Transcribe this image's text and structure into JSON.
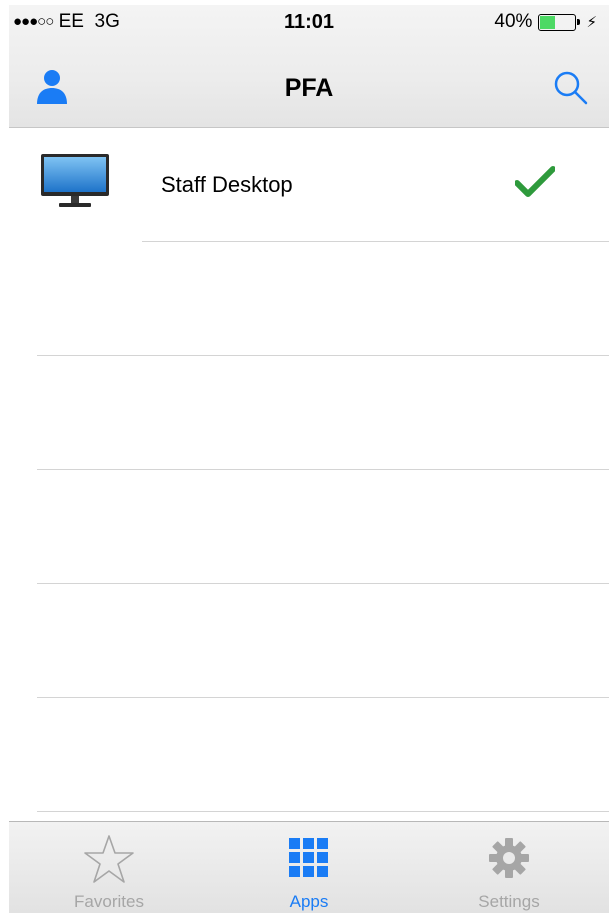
{
  "status_bar": {
    "signal": "●●●○○",
    "carrier": "EE",
    "network": "3G",
    "time": "11:01",
    "battery": "40%",
    "battery_level": 0.4
  },
  "navbar": {
    "title": "PFA",
    "left_icon": "user-icon",
    "right_icon": "search-icon"
  },
  "apps": [
    {
      "label": "Staff Desktop",
      "icon": "monitor-icon",
      "selected": true
    }
  ],
  "tabs": [
    {
      "label": "Favorites",
      "icon": "star-icon",
      "active": false
    },
    {
      "label": "Apps",
      "icon": "grid-icon",
      "active": true
    },
    {
      "label": "Settings",
      "icon": "gear-icon",
      "active": false
    }
  ],
  "colors": {
    "accent": "#1a7cf5",
    "check": "#2e9a3c",
    "battery_fill": "#4cd964",
    "inactive": "#a6a6a6"
  }
}
